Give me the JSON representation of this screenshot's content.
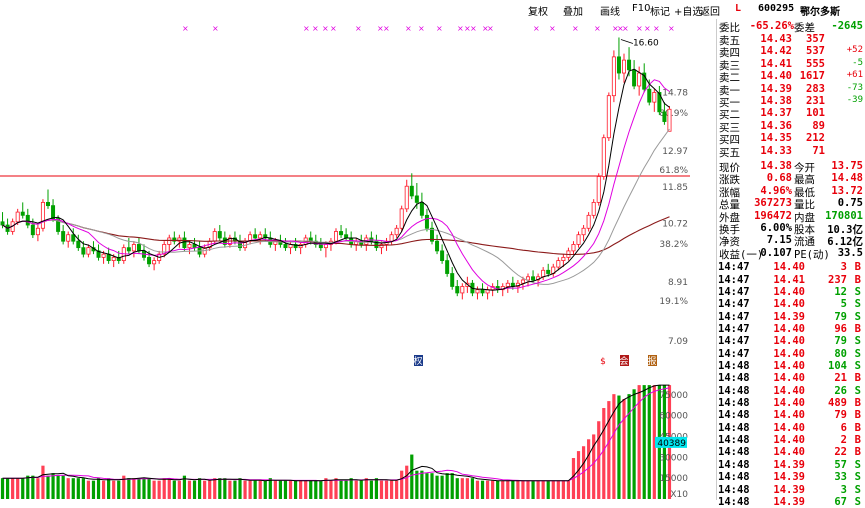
{
  "toolbar": {
    "items": [
      "复权",
      "叠加",
      "画线",
      "F10",
      "标记",
      "+自选",
      "返回"
    ]
  },
  "colors": {
    "up": "#ff1a2a",
    "down": "#00a000",
    "ma5": "#000000",
    "ma10": "#e000e0",
    "ma20": "#9a9a9a",
    "ma60": "#8b1a1a",
    "redline": "#e8000b",
    "cyanbox": "#00e5ee"
  },
  "chart": {
    "price_axis": {
      "ticks": [
        "14.78",
        "12.97",
        "11.85",
        "10.72",
        "8.91",
        "7.09"
      ],
      "pcts": [
        "80.9%",
        "61.8%",
        "38.2%",
        "19.1%"
      ]
    },
    "volume_axis": {
      "ticks": [
        "75000",
        "60000",
        "45000",
        "30000",
        "15000"
      ],
      "multiplier": "X10",
      "current": "40389"
    },
    "high_label": "16.60",
    "markers": [
      {
        "glyph": "权"
      },
      {
        "glyph": "$"
      },
      {
        "glyph": "会"
      },
      {
        "glyph": "报"
      }
    ]
  },
  "quote": {
    "code": "600295",
    "name": "鄂尔多斯",
    "flag": "L",
    "webi": {
      "label": "委比",
      "value": "-65.26%",
      "label2": "委差",
      "value2": "-2645"
    },
    "asks": [
      {
        "label": "卖五",
        "price": "14.43",
        "vol": "357",
        "chg": ""
      },
      {
        "label": "卖四",
        "price": "14.42",
        "vol": "537",
        "chg": "+52"
      },
      {
        "label": "卖三",
        "price": "14.41",
        "vol": "555",
        "chg": "-5"
      },
      {
        "label": "卖二",
        "price": "14.40",
        "vol": "1617",
        "chg": "+61"
      },
      {
        "label": "卖一",
        "price": "14.39",
        "vol": "283",
        "chg": "-73"
      }
    ],
    "bids": [
      {
        "label": "买一",
        "price": "14.38",
        "vol": "231",
        "chg": "-39"
      },
      {
        "label": "买二",
        "price": "14.37",
        "vol": "101",
        "chg": ""
      },
      {
        "label": "买三",
        "price": "14.36",
        "vol": "89",
        "chg": ""
      },
      {
        "label": "买四",
        "price": "14.35",
        "vol": "212",
        "chg": ""
      },
      {
        "label": "买五",
        "price": "14.33",
        "vol": "71",
        "chg": ""
      }
    ],
    "stats": [
      {
        "l1": "现价",
        "v1": "14.38",
        "c1": "red",
        "l2": "今开",
        "v2": "13.75",
        "c2": "red"
      },
      {
        "l1": "涨跌",
        "v1": "0.68",
        "c1": "red",
        "l2": "最高",
        "v2": "14.48",
        "c2": "red"
      },
      {
        "l1": "涨幅",
        "v1": "4.96%",
        "c1": "red",
        "l2": "最低",
        "v2": "13.72",
        "c2": "red"
      },
      {
        "l1": "总量",
        "v1": "367273",
        "c1": "red",
        "l2": "量比",
        "v2": "0.75",
        "c2": "black"
      },
      {
        "l1": "外盘",
        "v1": "196472",
        "c1": "red",
        "l2": "内盘",
        "v2": "170801",
        "c2": "green"
      },
      {
        "l1": "换手",
        "v1": "6.00%",
        "c1": "black",
        "l2": "股本",
        "v2": "10.3亿",
        "c2": "black"
      },
      {
        "l1": "净资",
        "v1": "7.15",
        "c1": "black",
        "l2": "流通",
        "v2": "6.12亿",
        "c2": "black"
      },
      {
        "l1": "收益(一)",
        "v1": "0.107",
        "c1": "black",
        "l2": "PE(动)",
        "v2": "33.5",
        "c2": "black"
      }
    ],
    "ticks": [
      {
        "time": "14:47",
        "price": "14.40",
        "vol": "3",
        "bs": "B"
      },
      {
        "time": "14:47",
        "price": "14.41",
        "vol": "237",
        "bs": "B"
      },
      {
        "time": "14:47",
        "price": "14.40",
        "vol": "12",
        "bs": "S"
      },
      {
        "time": "14:47",
        "price": "14.40",
        "vol": "5",
        "bs": "S"
      },
      {
        "time": "14:47",
        "price": "14.39",
        "vol": "79",
        "bs": "S"
      },
      {
        "time": "14:47",
        "price": "14.40",
        "vol": "96",
        "bs": "B"
      },
      {
        "time": "14:47",
        "price": "14.40",
        "vol": "79",
        "bs": "S"
      },
      {
        "time": "14:47",
        "price": "14.40",
        "vol": "80",
        "bs": "S"
      },
      {
        "time": "14:48",
        "price": "14.40",
        "vol": "104",
        "bs": "S"
      },
      {
        "time": "14:48",
        "price": "14.40",
        "vol": "21",
        "bs": "B"
      },
      {
        "time": "14:48",
        "price": "14.40",
        "vol": "26",
        "bs": "S"
      },
      {
        "time": "14:48",
        "price": "14.40",
        "vol": "489",
        "bs": "B"
      },
      {
        "time": "14:48",
        "price": "14.40",
        "vol": "79",
        "bs": "B"
      },
      {
        "time": "14:48",
        "price": "14.40",
        "vol": "6",
        "bs": "B"
      },
      {
        "time": "14:48",
        "price": "14.40",
        "vol": "2",
        "bs": "B"
      },
      {
        "time": "14:48",
        "price": "14.40",
        "vol": "22",
        "bs": "B"
      },
      {
        "time": "14:48",
        "price": "14.39",
        "vol": "57",
        "bs": "S"
      },
      {
        "time": "14:48",
        "price": "14.39",
        "vol": "33",
        "bs": "S"
      },
      {
        "time": "14:48",
        "price": "14.39",
        "vol": "3",
        "bs": "S"
      },
      {
        "time": "14:48",
        "price": "14.39",
        "vol": "67",
        "bs": "S"
      }
    ]
  },
  "chart_data": {
    "type": "candlestick",
    "price_range": [
      7.09,
      16.8
    ],
    "volume_range": [
      0,
      90000
    ],
    "series": [
      {
        "o": 10.9,
        "h": 11.2,
        "l": 10.7,
        "c": 10.8
      },
      {
        "o": 10.8,
        "h": 11.0,
        "l": 10.5,
        "c": 10.6
      },
      {
        "o": 10.6,
        "h": 11.0,
        "l": 10.5,
        "c": 10.9
      },
      {
        "o": 10.9,
        "h": 11.3,
        "l": 10.8,
        "c": 11.2
      },
      {
        "o": 11.2,
        "h": 11.5,
        "l": 11.0,
        "c": 11.1
      },
      {
        "o": 11.1,
        "h": 11.3,
        "l": 10.7,
        "c": 10.8
      },
      {
        "o": 10.8,
        "h": 11.0,
        "l": 10.4,
        "c": 10.5
      },
      {
        "o": 10.5,
        "h": 10.8,
        "l": 10.3,
        "c": 10.7
      },
      {
        "o": 10.7,
        "h": 11.6,
        "l": 10.6,
        "c": 11.5
      },
      {
        "o": 11.5,
        "h": 11.9,
        "l": 11.3,
        "c": 11.4
      },
      {
        "o": 11.4,
        "h": 11.6,
        "l": 10.9,
        "c": 11.0
      },
      {
        "o": 11.0,
        "h": 11.1,
        "l": 10.5,
        "c": 10.6
      },
      {
        "o": 10.6,
        "h": 10.8,
        "l": 10.2,
        "c": 10.3
      },
      {
        "o": 10.3,
        "h": 10.6,
        "l": 10.1,
        "c": 10.5
      },
      {
        "o": 10.5,
        "h": 10.7,
        "l": 10.2,
        "c": 10.3
      },
      {
        "o": 10.3,
        "h": 10.5,
        "l": 10.0,
        "c": 10.1
      },
      {
        "o": 10.1,
        "h": 10.3,
        "l": 9.8,
        "c": 9.9
      },
      {
        "o": 9.9,
        "h": 10.2,
        "l": 9.8,
        "c": 10.1
      },
      {
        "o": 10.1,
        "h": 10.3,
        "l": 9.9,
        "c": 10.0
      },
      {
        "o": 10.0,
        "h": 10.2,
        "l": 9.7,
        "c": 9.8
      },
      {
        "o": 9.8,
        "h": 10.0,
        "l": 9.6,
        "c": 9.9
      },
      {
        "o": 9.9,
        "h": 10.1,
        "l": 9.6,
        "c": 9.7
      },
      {
        "o": 9.7,
        "h": 9.9,
        "l": 9.5,
        "c": 9.8
      },
      {
        "o": 9.8,
        "h": 10.0,
        "l": 9.6,
        "c": 9.7
      },
      {
        "o": 9.7,
        "h": 10.2,
        "l": 9.6,
        "c": 10.1
      },
      {
        "o": 10.1,
        "h": 10.4,
        "l": 9.9,
        "c": 10.0
      },
      {
        "o": 10.0,
        "h": 10.3,
        "l": 9.8,
        "c": 10.2
      },
      {
        "o": 10.2,
        "h": 10.4,
        "l": 9.9,
        "c": 10.0
      },
      {
        "o": 10.0,
        "h": 10.2,
        "l": 9.7,
        "c": 9.8
      },
      {
        "o": 9.8,
        "h": 10.0,
        "l": 9.5,
        "c": 9.6
      },
      {
        "o": 9.6,
        "h": 9.8,
        "l": 9.4,
        "c": 9.7
      },
      {
        "o": 9.7,
        "h": 10.0,
        "l": 9.6,
        "c": 9.9
      },
      {
        "o": 9.9,
        "h": 10.3,
        "l": 9.8,
        "c": 10.2
      },
      {
        "o": 10.2,
        "h": 10.5,
        "l": 10.0,
        "c": 10.4
      },
      {
        "o": 10.4,
        "h": 10.6,
        "l": 10.2,
        "c": 10.3
      },
      {
        "o": 10.3,
        "h": 10.5,
        "l": 10.1,
        "c": 10.4
      },
      {
        "o": 10.4,
        "h": 10.6,
        "l": 10.0,
        "c": 10.1
      },
      {
        "o": 10.1,
        "h": 10.3,
        "l": 9.9,
        "c": 10.2
      },
      {
        "o": 10.2,
        "h": 10.4,
        "l": 10.0,
        "c": 10.1
      },
      {
        "o": 10.1,
        "h": 10.3,
        "l": 9.8,
        "c": 9.9
      },
      {
        "o": 9.9,
        "h": 10.2,
        "l": 9.8,
        "c": 10.1
      },
      {
        "o": 10.1,
        "h": 10.4,
        "l": 10.0,
        "c": 10.3
      },
      {
        "o": 10.3,
        "h": 10.7,
        "l": 10.2,
        "c": 10.6
      },
      {
        "o": 10.6,
        "h": 10.8,
        "l": 10.3,
        "c": 10.4
      },
      {
        "o": 10.4,
        "h": 10.6,
        "l": 10.1,
        "c": 10.2
      },
      {
        "o": 10.2,
        "h": 10.5,
        "l": 10.1,
        "c": 10.4
      },
      {
        "o": 10.4,
        "h": 10.6,
        "l": 10.2,
        "c": 10.3
      },
      {
        "o": 10.3,
        "h": 10.5,
        "l": 10.0,
        "c": 10.1
      },
      {
        "o": 10.1,
        "h": 10.4,
        "l": 10.0,
        "c": 10.3
      },
      {
        "o": 10.3,
        "h": 10.6,
        "l": 10.2,
        "c": 10.5
      },
      {
        "o": 10.5,
        "h": 10.7,
        "l": 10.3,
        "c": 10.4
      },
      {
        "o": 10.4,
        "h": 10.6,
        "l": 10.2,
        "c": 10.5
      },
      {
        "o": 10.5,
        "h": 10.7,
        "l": 10.3,
        "c": 10.4
      },
      {
        "o": 10.4,
        "h": 10.6,
        "l": 10.1,
        "c": 10.2
      },
      {
        "o": 10.2,
        "h": 10.4,
        "l": 10.0,
        "c": 10.3
      },
      {
        "o": 10.3,
        "h": 10.5,
        "l": 10.1,
        "c": 10.2
      },
      {
        "o": 10.2,
        "h": 10.4,
        "l": 10.0,
        "c": 10.1
      },
      {
        "o": 10.1,
        "h": 10.3,
        "l": 9.9,
        "c": 10.2
      },
      {
        "o": 10.2,
        "h": 10.4,
        "l": 10.0,
        "c": 10.1
      },
      {
        "o": 10.1,
        "h": 10.3,
        "l": 9.9,
        "c": 10.2
      },
      {
        "o": 10.2,
        "h": 10.5,
        "l": 10.1,
        "c": 10.4
      },
      {
        "o": 10.4,
        "h": 10.6,
        "l": 10.2,
        "c": 10.3
      },
      {
        "o": 10.3,
        "h": 10.5,
        "l": 10.1,
        "c": 10.2
      },
      {
        "o": 10.2,
        "h": 10.4,
        "l": 10.0,
        "c": 10.1
      },
      {
        "o": 10.1,
        "h": 10.3,
        "l": 9.8,
        "c": 10.2
      },
      {
        "o": 10.2,
        "h": 10.4,
        "l": 10.0,
        "c": 10.3
      },
      {
        "o": 10.3,
        "h": 10.7,
        "l": 10.2,
        "c": 10.6
      },
      {
        "o": 10.6,
        "h": 10.8,
        "l": 10.4,
        "c": 10.5
      },
      {
        "o": 10.5,
        "h": 10.7,
        "l": 10.3,
        "c": 10.4
      },
      {
        "o": 10.4,
        "h": 10.6,
        "l": 10.1,
        "c": 10.2
      },
      {
        "o": 10.2,
        "h": 10.4,
        "l": 10.0,
        "c": 10.3
      },
      {
        "o": 10.3,
        "h": 10.5,
        "l": 10.1,
        "c": 10.2
      },
      {
        "o": 10.2,
        "h": 10.5,
        "l": 10.0,
        "c": 10.4
      },
      {
        "o": 10.4,
        "h": 10.6,
        "l": 10.2,
        "c": 10.3
      },
      {
        "o": 10.3,
        "h": 10.5,
        "l": 10.0,
        "c": 10.1
      },
      {
        "o": 10.1,
        "h": 10.3,
        "l": 9.9,
        "c": 10.2
      },
      {
        "o": 10.2,
        "h": 10.4,
        "l": 10.0,
        "c": 10.3
      },
      {
        "o": 10.3,
        "h": 10.6,
        "l": 10.2,
        "c": 10.5
      },
      {
        "o": 10.5,
        "h": 10.8,
        "l": 10.4,
        "c": 10.7
      },
      {
        "o": 10.7,
        "h": 11.4,
        "l": 10.6,
        "c": 11.3
      },
      {
        "o": 11.3,
        "h": 12.2,
        "l": 11.2,
        "c": 12.0
      },
      {
        "o": 12.0,
        "h": 12.4,
        "l": 11.6,
        "c": 11.7
      },
      {
        "o": 11.7,
        "h": 12.1,
        "l": 11.3,
        "c": 11.5
      },
      {
        "o": 11.5,
        "h": 11.8,
        "l": 11.0,
        "c": 11.1
      },
      {
        "o": 11.1,
        "h": 11.3,
        "l": 10.6,
        "c": 10.7
      },
      {
        "o": 10.7,
        "h": 10.9,
        "l": 10.2,
        "c": 10.3
      },
      {
        "o": 10.3,
        "h": 10.5,
        "l": 9.9,
        "c": 10.0
      },
      {
        "o": 10.0,
        "h": 10.2,
        "l": 9.6,
        "c": 9.7
      },
      {
        "o": 9.7,
        "h": 9.9,
        "l": 9.2,
        "c": 9.3
      },
      {
        "o": 9.3,
        "h": 9.5,
        "l": 8.8,
        "c": 8.9
      },
      {
        "o": 8.9,
        "h": 9.1,
        "l": 8.6,
        "c": 8.7
      },
      {
        "o": 8.7,
        "h": 9.0,
        "l": 8.5,
        "c": 8.9
      },
      {
        "o": 8.9,
        "h": 9.2,
        "l": 8.7,
        "c": 9.0
      },
      {
        "o": 9.0,
        "h": 9.1,
        "l": 8.6,
        "c": 8.7
      },
      {
        "o": 8.7,
        "h": 8.9,
        "l": 8.5,
        "c": 8.8
      },
      {
        "o": 8.8,
        "h": 9.0,
        "l": 8.6,
        "c": 8.7
      },
      {
        "o": 8.7,
        "h": 8.9,
        "l": 8.5,
        "c": 8.8
      },
      {
        "o": 8.8,
        "h": 9.0,
        "l": 8.6,
        "c": 8.9
      },
      {
        "o": 8.9,
        "h": 9.1,
        "l": 8.7,
        "c": 8.8
      },
      {
        "o": 8.8,
        "h": 9.0,
        "l": 8.6,
        "c": 8.9
      },
      {
        "o": 8.9,
        "h": 9.1,
        "l": 8.7,
        "c": 9.0
      },
      {
        "o": 9.0,
        "h": 9.2,
        "l": 8.8,
        "c": 8.9
      },
      {
        "o": 8.9,
        "h": 9.1,
        "l": 8.7,
        "c": 9.0
      },
      {
        "o": 9.0,
        "h": 9.2,
        "l": 8.8,
        "c": 9.1
      },
      {
        "o": 9.1,
        "h": 9.3,
        "l": 8.9,
        "c": 9.2
      },
      {
        "o": 9.2,
        "h": 9.4,
        "l": 9.0,
        "c": 9.1
      },
      {
        "o": 9.1,
        "h": 9.3,
        "l": 8.9,
        "c": 9.2
      },
      {
        "o": 9.2,
        "h": 9.5,
        "l": 9.1,
        "c": 9.4
      },
      {
        "o": 9.4,
        "h": 9.6,
        "l": 9.2,
        "c": 9.3
      },
      {
        "o": 9.3,
        "h": 9.6,
        "l": 9.2,
        "c": 9.5
      },
      {
        "o": 9.5,
        "h": 9.8,
        "l": 9.4,
        "c": 9.7
      },
      {
        "o": 9.7,
        "h": 9.9,
        "l": 9.5,
        "c": 9.8
      },
      {
        "o": 9.8,
        "h": 10.1,
        "l": 9.7,
        "c": 10.0
      },
      {
        "o": 10.0,
        "h": 10.3,
        "l": 9.9,
        "c": 10.2
      },
      {
        "o": 10.2,
        "h": 10.6,
        "l": 10.1,
        "c": 10.5
      },
      {
        "o": 10.5,
        "h": 10.8,
        "l": 10.3,
        "c": 10.7
      },
      {
        "o": 10.7,
        "h": 11.2,
        "l": 10.6,
        "c": 11.1
      },
      {
        "o": 11.1,
        "h": 11.6,
        "l": 11.0,
        "c": 11.5
      },
      {
        "o": 11.5,
        "h": 12.4,
        "l": 11.4,
        "c": 12.3
      },
      {
        "o": 12.3,
        "h": 13.6,
        "l": 12.2,
        "c": 13.5
      },
      {
        "o": 13.5,
        "h": 14.9,
        "l": 13.4,
        "c": 14.8
      },
      {
        "o": 14.8,
        "h": 16.2,
        "l": 14.6,
        "c": 16.0
      },
      {
        "o": 16.0,
        "h": 16.6,
        "l": 15.3,
        "c": 15.5
      },
      {
        "o": 15.5,
        "h": 16.1,
        "l": 15.2,
        "c": 15.9
      },
      {
        "o": 15.9,
        "h": 16.3,
        "l": 15.4,
        "c": 15.6
      },
      {
        "o": 15.6,
        "h": 15.9,
        "l": 15.0,
        "c": 15.1
      },
      {
        "o": 15.1,
        "h": 15.7,
        "l": 14.8,
        "c": 15.5
      },
      {
        "o": 15.5,
        "h": 15.8,
        "l": 14.9,
        "c": 15.0
      },
      {
        "o": 15.0,
        "h": 15.3,
        "l": 14.5,
        "c": 14.6
      },
      {
        "o": 14.6,
        "h": 15.0,
        "l": 14.3,
        "c": 14.9
      },
      {
        "o": 14.9,
        "h": 15.1,
        "l": 14.2,
        "c": 14.3
      },
      {
        "o": 14.3,
        "h": 14.6,
        "l": 13.9,
        "c": 14.0
      },
      {
        "o": 13.7,
        "h": 14.48,
        "l": 13.72,
        "c": 14.38
      }
    ]
  }
}
